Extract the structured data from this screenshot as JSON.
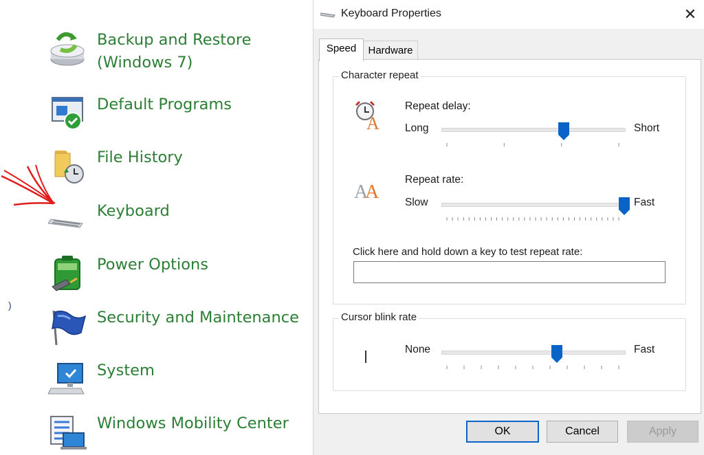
{
  "control_panel": {
    "items": [
      {
        "label_line1": "Backup and Restore",
        "label_line2": "(Windows 7)",
        "icon": "backup-restore-icon"
      },
      {
        "label": "Default Programs",
        "icon": "default-programs-icon"
      },
      {
        "label": "File History",
        "icon": "file-history-icon"
      },
      {
        "label": "Keyboard",
        "icon": "keyboard-icon"
      },
      {
        "label": "Power Options",
        "icon": "power-options-icon"
      },
      {
        "label": "Security and Maintenance",
        "icon": "security-flag-icon"
      },
      {
        "label": "System",
        "icon": "system-icon"
      },
      {
        "label": "Windows Mobility Center",
        "icon": "mobility-center-icon"
      }
    ],
    "label_color": "#2b7f34",
    "annotation": "red-arrow-pointing-at-keyboard"
  },
  "dialog": {
    "title": "Keyboard Properties",
    "close_label": "✕",
    "tabs": [
      {
        "label": "Speed",
        "selected": true
      },
      {
        "label": "Hardware",
        "selected": false
      }
    ],
    "character_repeat": {
      "group_title": "Character repeat",
      "repeat_delay": {
        "label": "Repeat delay:",
        "min_label": "Long",
        "max_label": "Short",
        "value_fraction": 0.67,
        "tick_count": 4
      },
      "repeat_rate": {
        "label": "Repeat rate:",
        "min_label": "Slow",
        "max_label": "Fast",
        "value_fraction": 1.0,
        "tick_count": 32
      },
      "test_prompt": "Click here and hold down a key to test repeat rate:",
      "test_value": ""
    },
    "cursor_blink": {
      "group_title": "Cursor blink rate",
      "min_label": "None",
      "max_label": "Fast",
      "value_fraction": 0.63,
      "tick_count": 11
    },
    "buttons": {
      "ok": "OK",
      "cancel": "Cancel",
      "apply": "Apply"
    },
    "accent_color": "#0a64c8"
  }
}
